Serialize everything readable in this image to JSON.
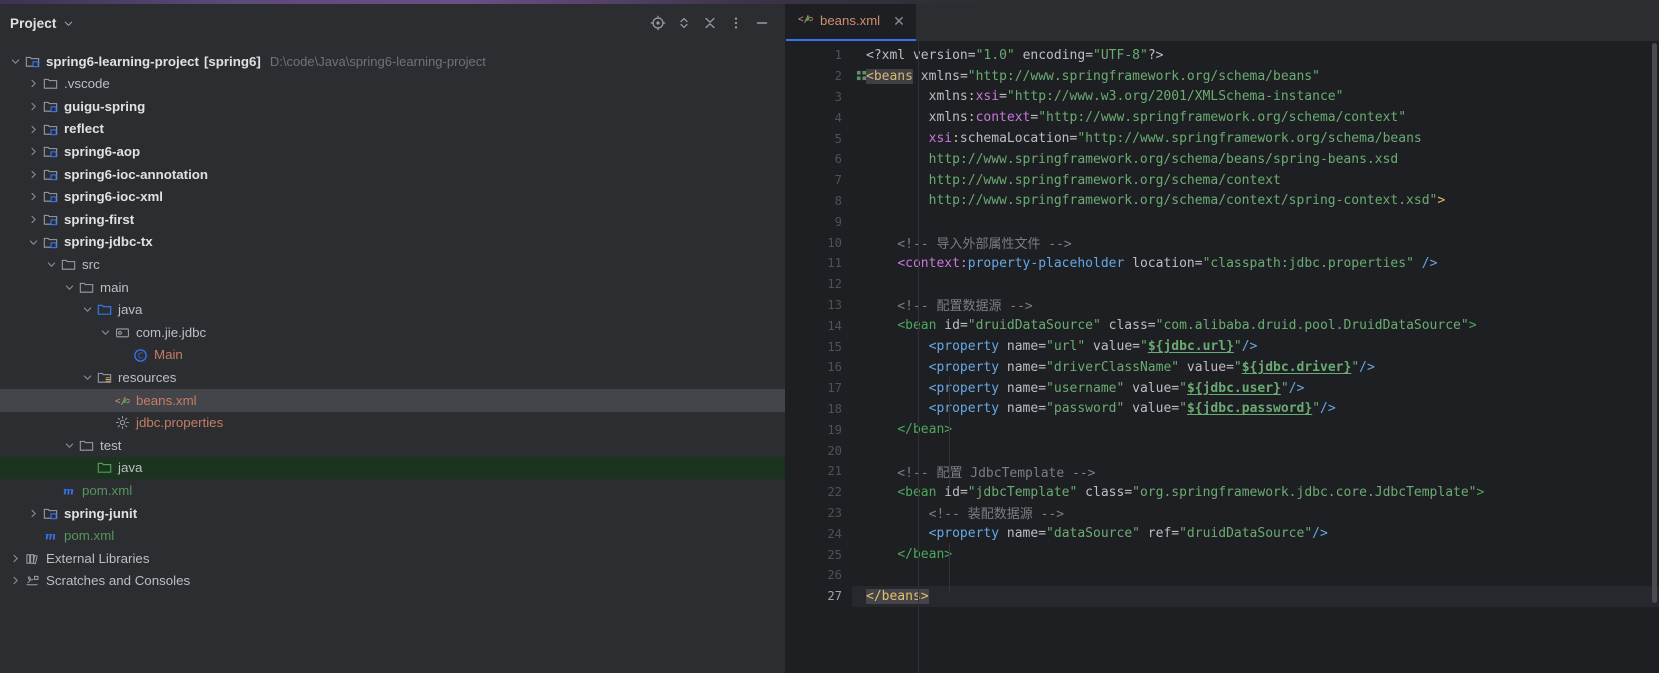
{
  "window": {
    "accent_color": "#6b4f86",
    "bg": "#2b2d30"
  },
  "project_panel": {
    "title": "Project",
    "title_chevron_icon": "chevron-down-icon",
    "toolbar": [
      {
        "name": "select-opened-file-icon",
        "glyph": "locate"
      },
      {
        "name": "expand-collapse-icon",
        "glyph": "diamond"
      },
      {
        "name": "collapse-all-icon",
        "glyph": "collapse"
      },
      {
        "name": "more-options-icon",
        "glyph": "dots"
      },
      {
        "name": "hide-panel-icon",
        "glyph": "minus"
      }
    ],
    "tree": [
      {
        "depth": 0,
        "arrow": "down",
        "icon": "module-folder-icon",
        "label": "spring6-learning-project",
        "tag": "[spring6]",
        "sub": "D:\\code\\Java\\spring6-learning-project",
        "style": "bold"
      },
      {
        "depth": 1,
        "arrow": "right",
        "icon": "folder-icon",
        "label": ".vscode",
        "style": "plain"
      },
      {
        "depth": 1,
        "arrow": "right",
        "icon": "module-folder-icon",
        "label": "guigu-spring",
        "style": "bold"
      },
      {
        "depth": 1,
        "arrow": "right",
        "icon": "module-folder-icon",
        "label": "reflect",
        "style": "bold"
      },
      {
        "depth": 1,
        "arrow": "right",
        "icon": "module-folder-icon",
        "label": "spring6-aop",
        "style": "bold"
      },
      {
        "depth": 1,
        "arrow": "right",
        "icon": "module-folder-icon",
        "label": "spring6-ioc-annotation",
        "style": "bold"
      },
      {
        "depth": 1,
        "arrow": "right",
        "icon": "module-folder-icon",
        "label": "spring6-ioc-xml",
        "style": "bold"
      },
      {
        "depth": 1,
        "arrow": "right",
        "icon": "module-folder-icon",
        "label": "spring-first",
        "style": "bold"
      },
      {
        "depth": 1,
        "arrow": "down",
        "icon": "module-folder-icon",
        "label": "spring-jdbc-tx",
        "style": "bold"
      },
      {
        "depth": 2,
        "arrow": "down",
        "icon": "folder-icon",
        "label": "src",
        "style": "plain"
      },
      {
        "depth": 3,
        "arrow": "down",
        "icon": "folder-icon",
        "label": "main",
        "style": "plain"
      },
      {
        "depth": 4,
        "arrow": "down",
        "icon": "source-folder-icon",
        "label": "java",
        "style": "plain"
      },
      {
        "depth": 5,
        "arrow": "down",
        "icon": "package-icon",
        "label": "com.jie.jdbc",
        "style": "plain"
      },
      {
        "depth": 6,
        "arrow": "none",
        "icon": "java-class-icon",
        "label": "Main",
        "style": "red"
      },
      {
        "depth": 4,
        "arrow": "down",
        "icon": "resources-folder-icon",
        "label": "resources",
        "style": "plain"
      },
      {
        "depth": 5,
        "arrow": "none",
        "icon": "spring-xml-icon",
        "label": "beans.xml",
        "style": "red",
        "state": "selected"
      },
      {
        "depth": 5,
        "arrow": "none",
        "icon": "properties-icon",
        "label": "jdbc.properties",
        "style": "red"
      },
      {
        "depth": 3,
        "arrow": "down",
        "icon": "folder-icon",
        "label": "test",
        "style": "plain"
      },
      {
        "depth": 4,
        "arrow": "none",
        "icon": "test-source-folder-icon",
        "label": "java",
        "style": "plain",
        "state": "testroot"
      },
      {
        "depth": 2,
        "arrow": "none",
        "icon": "maven-icon",
        "label": "pom.xml",
        "style": "green"
      },
      {
        "depth": 1,
        "arrow": "right",
        "icon": "module-folder-icon",
        "label": "spring-junit",
        "style": "bold"
      },
      {
        "depth": 1,
        "arrow": "none",
        "icon": "maven-icon",
        "label": "pom.xml",
        "style": "green"
      },
      {
        "depth": 0,
        "arrow": "right",
        "icon": "external-libraries-icon",
        "label": "External Libraries",
        "style": "plain"
      },
      {
        "depth": 0,
        "arrow": "right",
        "icon": "scratches-icon",
        "label": "Scratches and Consoles",
        "style": "plain"
      }
    ]
  },
  "editor": {
    "tabs": [
      {
        "label": "beans.xml",
        "icon": "spring-xml-icon",
        "close_icon": "close-icon",
        "active": true
      }
    ],
    "current_line": 27,
    "lines": [
      {
        "n": 1,
        "tokens": [
          {
            "t": "punc",
            "v": "<?xml "
          },
          {
            "t": "attr",
            "v": "version"
          },
          {
            "t": "punc",
            "v": "="
          },
          {
            "t": "val",
            "v": "\"1.0\""
          },
          {
            "t": "punc",
            "v": " "
          },
          {
            "t": "attr",
            "v": "encoding"
          },
          {
            "t": "punc",
            "v": "="
          },
          {
            "t": "val",
            "v": "\"UTF-8\""
          },
          {
            "t": "punc",
            "v": "?>"
          }
        ]
      },
      {
        "n": 2,
        "fold": true,
        "tokens": [
          {
            "t": "hl",
            "v": "<beans"
          },
          {
            "t": "attr",
            "v": " xmlns"
          },
          {
            "t": "punc",
            "v": "="
          },
          {
            "t": "val",
            "v": "\"http://www.springframework.org/schema/beans\""
          }
        ]
      },
      {
        "n": 3,
        "tokens": [
          {
            "t": "attr",
            "v": "        xmlns:"
          },
          {
            "t": "ns",
            "v": "xsi"
          },
          {
            "t": "punc",
            "v": "="
          },
          {
            "t": "val",
            "v": "\"http://www.w3.org/2001/XMLSchema-instance\""
          }
        ]
      },
      {
        "n": 4,
        "tokens": [
          {
            "t": "attr",
            "v": "        xmlns:"
          },
          {
            "t": "ns",
            "v": "context"
          },
          {
            "t": "punc",
            "v": "="
          },
          {
            "t": "val",
            "v": "\"http://www.springframework.org/schema/context\""
          }
        ]
      },
      {
        "n": 5,
        "tokens": [
          {
            "t": "attr",
            "v": "        "
          },
          {
            "t": "ns",
            "v": "xsi"
          },
          {
            "t": "attr",
            "v": ":schemaLocation"
          },
          {
            "t": "punc",
            "v": "="
          },
          {
            "t": "val",
            "v": "\"http://www.springframework.org/schema/beans"
          }
        ]
      },
      {
        "n": 6,
        "tokens": [
          {
            "t": "val",
            "v": "        http://www.springframework.org/schema/beans/spring-beans.xsd"
          }
        ]
      },
      {
        "n": 7,
        "tokens": [
          {
            "t": "val",
            "v": "        http://www.springframework.org/schema/context"
          }
        ]
      },
      {
        "n": 8,
        "tokens": [
          {
            "t": "val",
            "v": "        http://www.springframework.org/schema/context/spring-context.xsd\""
          },
          {
            "t": "arrowend",
            "v": ">"
          }
        ]
      },
      {
        "n": 9,
        "tokens": []
      },
      {
        "n": 10,
        "tokens": [
          {
            "t": "comment",
            "v": "    <!-- 导入外部属性文件 -->"
          }
        ]
      },
      {
        "n": 11,
        "tokens": [
          {
            "t": "punc",
            "v": "    "
          },
          {
            "t": "tagns",
            "v": "<context:"
          },
          {
            "t": "tag",
            "v": "property-placeholder"
          },
          {
            "t": "attr",
            "v": " location"
          },
          {
            "t": "punc",
            "v": "="
          },
          {
            "t": "val",
            "v": "\"classpath:jdbc.properties\""
          },
          {
            "t": "tag",
            "v": " />"
          }
        ]
      },
      {
        "n": 12,
        "tokens": []
      },
      {
        "n": 13,
        "tokens": [
          {
            "t": "comment",
            "v": "    <!-- 配置数据源 -->"
          }
        ]
      },
      {
        "n": 14,
        "tokens": [
          {
            "t": "punc",
            "v": "    "
          },
          {
            "t": "tagc",
            "v": "<bean"
          },
          {
            "t": "attr",
            "v": " id"
          },
          {
            "t": "punc",
            "v": "="
          },
          {
            "t": "val",
            "v": "\"druidDataSource\""
          },
          {
            "t": "attr",
            "v": " class"
          },
          {
            "t": "punc",
            "v": "="
          },
          {
            "t": "val",
            "v": "\"com.alibaba.druid.pool.DruidDataSource\""
          },
          {
            "t": "tagc",
            "v": ">"
          }
        ]
      },
      {
        "n": 15,
        "tokens": [
          {
            "t": "punc",
            "v": "        "
          },
          {
            "t": "tag",
            "v": "<property"
          },
          {
            "t": "attr",
            "v": " name"
          },
          {
            "t": "punc",
            "v": "="
          },
          {
            "t": "val",
            "v": "\"url\""
          },
          {
            "t": "attr",
            "v": " value"
          },
          {
            "t": "punc",
            "v": "="
          },
          {
            "t": "val",
            "v": "\""
          },
          {
            "t": "macro",
            "v": "${jdbc.url}"
          },
          {
            "t": "val",
            "v": "\""
          },
          {
            "t": "tag",
            "v": "/>"
          }
        ]
      },
      {
        "n": 16,
        "tokens": [
          {
            "t": "punc",
            "v": "        "
          },
          {
            "t": "tag",
            "v": "<property"
          },
          {
            "t": "attr",
            "v": " name"
          },
          {
            "t": "punc",
            "v": "="
          },
          {
            "t": "val",
            "v": "\"driverClassName\""
          },
          {
            "t": "attr",
            "v": " value"
          },
          {
            "t": "punc",
            "v": "="
          },
          {
            "t": "val",
            "v": "\""
          },
          {
            "t": "macro",
            "v": "${jdbc.driver}"
          },
          {
            "t": "val",
            "v": "\""
          },
          {
            "t": "tag",
            "v": "/>"
          }
        ]
      },
      {
        "n": 17,
        "tokens": [
          {
            "t": "punc",
            "v": "        "
          },
          {
            "t": "tag",
            "v": "<property"
          },
          {
            "t": "attr",
            "v": " name"
          },
          {
            "t": "punc",
            "v": "="
          },
          {
            "t": "val",
            "v": "\"username\""
          },
          {
            "t": "attr",
            "v": " value"
          },
          {
            "t": "punc",
            "v": "="
          },
          {
            "t": "val",
            "v": "\""
          },
          {
            "t": "macro",
            "v": "${jdbc.user}"
          },
          {
            "t": "val",
            "v": "\""
          },
          {
            "t": "tag",
            "v": "/>"
          }
        ]
      },
      {
        "n": 18,
        "tokens": [
          {
            "t": "punc",
            "v": "        "
          },
          {
            "t": "tag",
            "v": "<property"
          },
          {
            "t": "attr",
            "v": " name"
          },
          {
            "t": "punc",
            "v": "="
          },
          {
            "t": "val",
            "v": "\"password\""
          },
          {
            "t": "attr",
            "v": " value"
          },
          {
            "t": "punc",
            "v": "="
          },
          {
            "t": "val",
            "v": "\""
          },
          {
            "t": "macro",
            "v": "${jdbc.password}"
          },
          {
            "t": "val",
            "v": "\""
          },
          {
            "t": "tag",
            "v": "/>"
          }
        ]
      },
      {
        "n": 19,
        "tokens": [
          {
            "t": "punc",
            "v": "    "
          },
          {
            "t": "tagc",
            "v": "</bean>"
          }
        ]
      },
      {
        "n": 20,
        "tokens": []
      },
      {
        "n": 21,
        "tokens": [
          {
            "t": "comment",
            "v": "    <!-- 配置 JdbcTemplate -->"
          }
        ]
      },
      {
        "n": 22,
        "tokens": [
          {
            "t": "punc",
            "v": "    "
          },
          {
            "t": "tagc",
            "v": "<bean"
          },
          {
            "t": "attr",
            "v": " id"
          },
          {
            "t": "punc",
            "v": "="
          },
          {
            "t": "val",
            "v": "\"jdbcTemplate\""
          },
          {
            "t": "attr",
            "v": " class"
          },
          {
            "t": "punc",
            "v": "="
          },
          {
            "t": "val",
            "v": "\"org.springframework.jdbc.core.JdbcTemplate\""
          },
          {
            "t": "tagc",
            "v": ">"
          }
        ]
      },
      {
        "n": 23,
        "tokens": [
          {
            "t": "comment",
            "v": "        <!-- 装配数据源 -->"
          }
        ]
      },
      {
        "n": 24,
        "tokens": [
          {
            "t": "punc",
            "v": "        "
          },
          {
            "t": "tag",
            "v": "<property"
          },
          {
            "t": "attr",
            "v": " name"
          },
          {
            "t": "punc",
            "v": "="
          },
          {
            "t": "val",
            "v": "\"dataSource\""
          },
          {
            "t": "attr",
            "v": " ref"
          },
          {
            "t": "punc",
            "v": "="
          },
          {
            "t": "val",
            "v": "\"druidDataSource\""
          },
          {
            "t": "tag",
            "v": "/>"
          }
        ]
      },
      {
        "n": 25,
        "tokens": [
          {
            "t": "punc",
            "v": "    "
          },
          {
            "t": "tagc",
            "v": "</bean>"
          }
        ]
      },
      {
        "n": 26,
        "tokens": []
      },
      {
        "n": 27,
        "tokens": [
          {
            "t": "beanshl",
            "v": "</beans>"
          }
        ]
      }
    ]
  }
}
